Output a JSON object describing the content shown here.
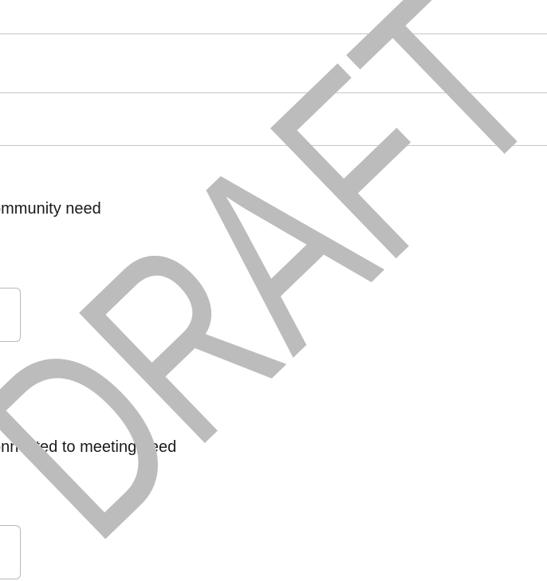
{
  "form": {
    "question_1": {
      "label": "ommunity need",
      "answer": ""
    },
    "question_2": {
      "label": "onnected to meeting need",
      "answer": ""
    }
  },
  "watermark": {
    "text": "DRAFT",
    "color": "#bcbcbc"
  }
}
